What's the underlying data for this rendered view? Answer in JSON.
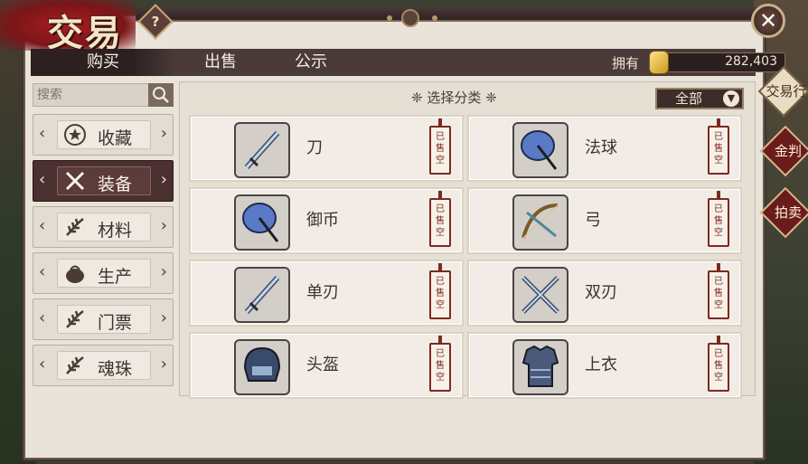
{
  "header": {
    "title": "交易",
    "help_label": "?",
    "close_label": "✕"
  },
  "tabs": [
    {
      "label": "购买",
      "active": true
    },
    {
      "label": "出售",
      "active": false
    },
    {
      "label": "公示",
      "active": false
    }
  ],
  "currency": {
    "label": "拥有",
    "value": "282,403",
    "icon": "gold-coin-icon"
  },
  "search": {
    "placeholder": "搜索"
  },
  "categories": [
    {
      "label": "收藏",
      "icon": "star-icon",
      "active": false
    },
    {
      "label": "装备",
      "icon": "crossed-swords-icon",
      "active": true
    },
    {
      "label": "材料",
      "icon": "herb-icon",
      "active": false
    },
    {
      "label": "生产",
      "icon": "pot-icon",
      "active": false
    },
    {
      "label": "门票",
      "icon": "herb-icon",
      "active": false
    },
    {
      "label": "魂珠",
      "icon": "herb-icon",
      "active": false
    }
  ],
  "content": {
    "header": "❈  选择分类  ❈",
    "filter": "全部",
    "items": [
      {
        "name": "刀",
        "icon": "blade-icon",
        "tag": "已售空"
      },
      {
        "name": "法球",
        "icon": "umbrella-icon",
        "tag": "已售空"
      },
      {
        "name": "御币",
        "icon": "umbrella-icon",
        "tag": "已售空"
      },
      {
        "name": "弓",
        "icon": "bow-icon",
        "tag": "已售空"
      },
      {
        "name": "单刃",
        "icon": "blade-icon",
        "tag": "已售空"
      },
      {
        "name": "双刃",
        "icon": "twin-blades-icon",
        "tag": "已售空"
      },
      {
        "name": "头盔",
        "icon": "helmet-icon",
        "tag": "已售空"
      },
      {
        "name": "上衣",
        "icon": "armor-icon",
        "tag": "已售空"
      }
    ]
  },
  "side_tabs": [
    {
      "label": "交易行"
    },
    {
      "label": "金判"
    },
    {
      "label": "拍卖"
    }
  ],
  "colors": {
    "accent_dark": "#4a3030",
    "tag_red": "#7a2a22",
    "panel_bg": "#e9e3da"
  }
}
